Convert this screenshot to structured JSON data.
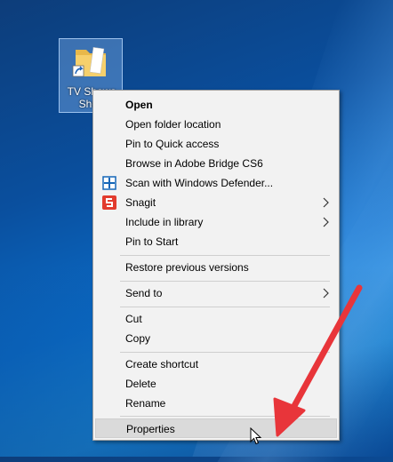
{
  "desktop": {
    "icon_label_line1": "TV Shows",
    "icon_label_line2": "Short"
  },
  "menu": {
    "items": [
      {
        "label": "Open",
        "bold": true
      },
      {
        "label": "Open folder location"
      },
      {
        "label": "Pin to Quick access"
      },
      {
        "label": "Browse in Adobe Bridge CS6"
      },
      {
        "label": "Scan with Windows Defender...",
        "icon": "windows-defender-icon"
      },
      {
        "label": "Snagit",
        "icon": "snagit-icon",
        "submenu": true
      },
      {
        "label": "Include in library",
        "submenu": true
      },
      {
        "label": "Pin to Start"
      },
      {
        "label": "Restore previous versions"
      },
      {
        "label": "Send to",
        "submenu": true
      },
      {
        "label": "Cut"
      },
      {
        "label": "Copy"
      },
      {
        "label": "Create shortcut"
      },
      {
        "label": "Delete"
      },
      {
        "label": "Rename"
      },
      {
        "label": "Properties",
        "highlighted": true
      }
    ]
  },
  "colors": {
    "menu_bg": "#f2f2f2",
    "highlight": "#dadada",
    "annotation_arrow": "#e8353a",
    "defender_blue": "#1466b8",
    "snagit_red": "#e23b2e"
  }
}
